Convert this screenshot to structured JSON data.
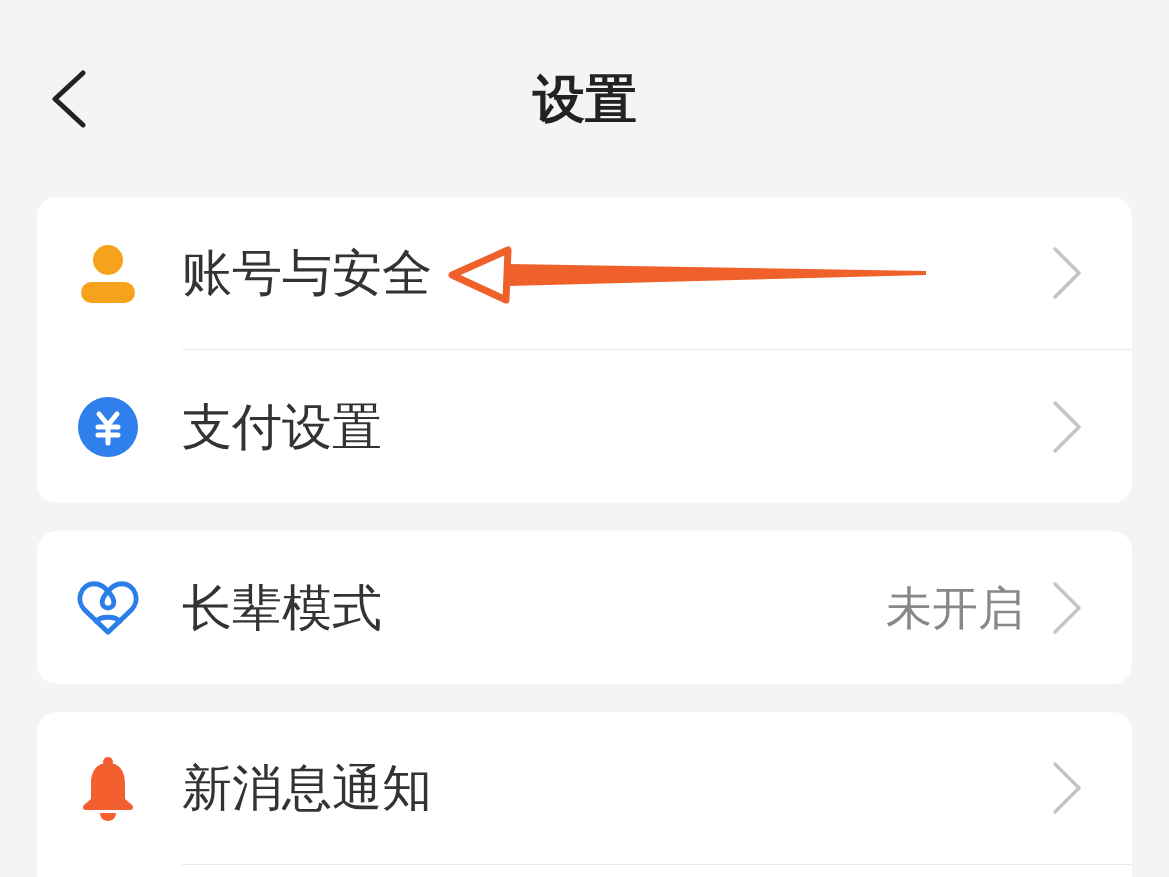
{
  "header": {
    "title": "设置"
  },
  "groups": [
    {
      "items": [
        {
          "label": "账号与安全"
        },
        {
          "label": "支付设置"
        }
      ]
    },
    {
      "items": [
        {
          "label": "长辈模式",
          "value": "未开启"
        }
      ]
    },
    {
      "items": [
        {
          "label": "新消息通知"
        }
      ]
    }
  ]
}
